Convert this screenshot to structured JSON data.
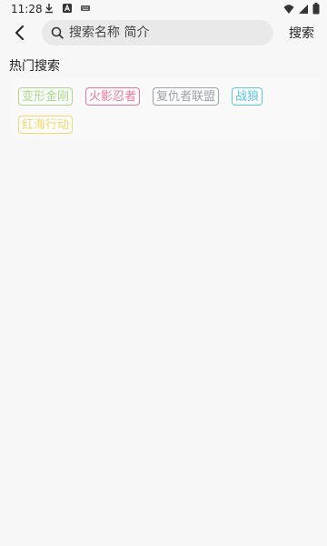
{
  "status_bar": {
    "time": "11:28",
    "left_icons": [
      "download-icon",
      "a-notification-icon",
      "keyboard-icon"
    ],
    "right_icons": [
      "wifi-icon",
      "cell-signal-icon",
      "battery-icon"
    ]
  },
  "header": {
    "back_icon": "chevron-left-icon",
    "search_placeholder": "搜索名称 简介",
    "search_value": "",
    "search_button_label": "搜索"
  },
  "hot_search": {
    "title": "热门搜索",
    "tags": [
      {
        "label": "变形金刚",
        "color": "#a8d98a"
      },
      {
        "label": "火影忍者",
        "color": "#e8759a"
      },
      {
        "label": "复仇者联盟",
        "color": "#9aa3ad"
      },
      {
        "label": "战狼",
        "color": "#5cc9de"
      },
      {
        "label": "红海行动",
        "color": "#f2d86c"
      }
    ]
  }
}
